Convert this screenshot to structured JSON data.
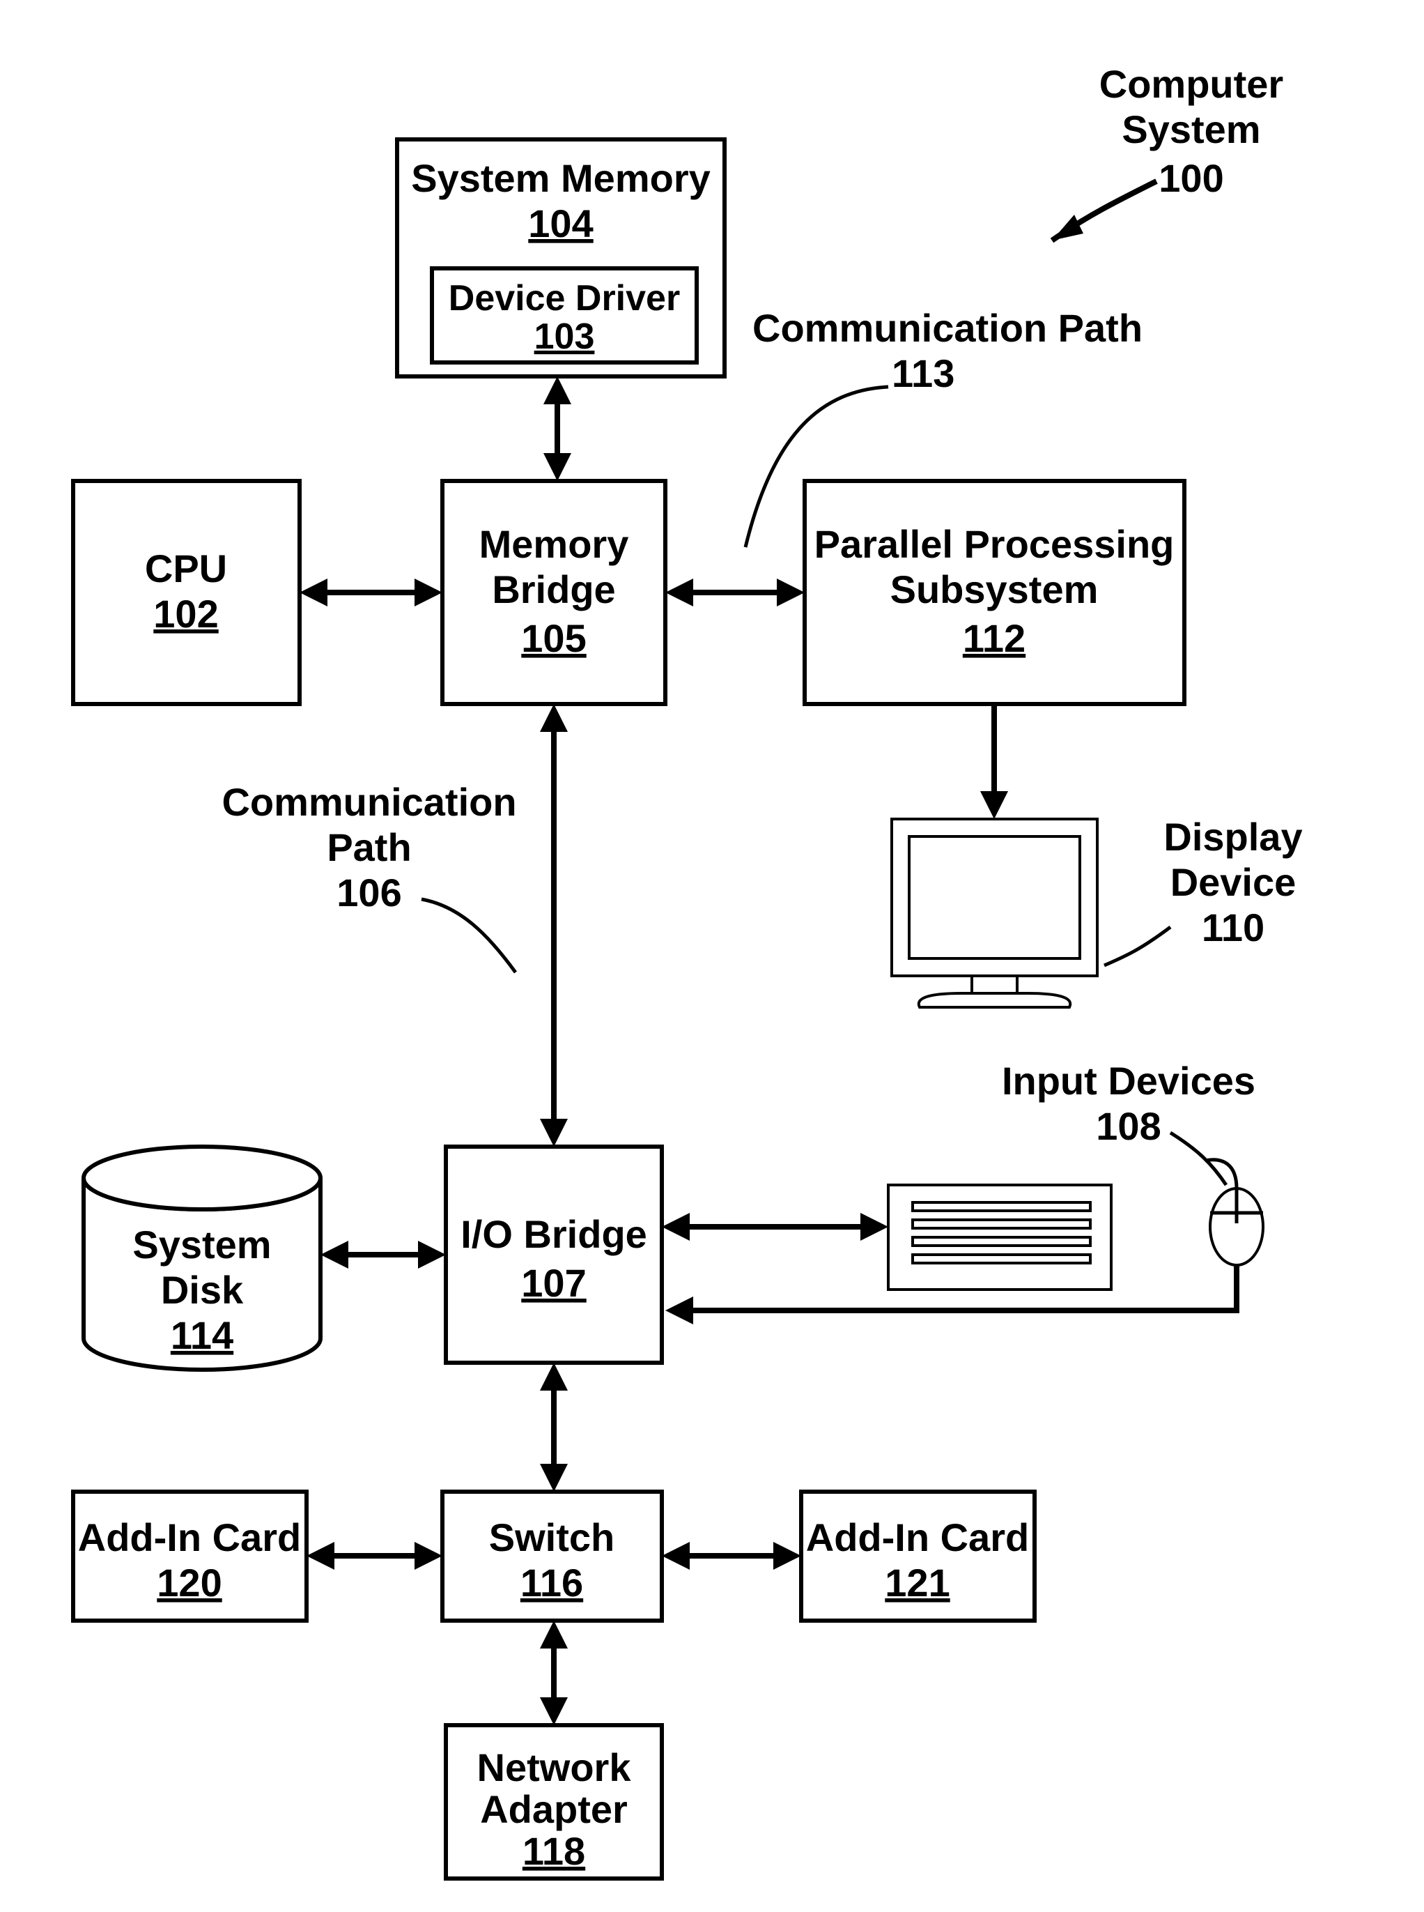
{
  "title": {
    "l1": "Computer",
    "l2": "System",
    "num": "100"
  },
  "sysmem": {
    "label": "System Memory",
    "num": "104"
  },
  "devdrv": {
    "label": "Device Driver",
    "num": "103"
  },
  "commpath113": {
    "l1": "Communication Path",
    "num": "113"
  },
  "cpu": {
    "label": "CPU",
    "num": "102"
  },
  "membridge": {
    "l1": "Memory",
    "l2": "Bridge",
    "num": "105"
  },
  "pps": {
    "l1": "Parallel Processing",
    "l2": "Subsystem",
    "num": "112"
  },
  "commpath106": {
    "l1": "Communication",
    "l2": "Path",
    "num": "106"
  },
  "display": {
    "l1": "Display",
    "l2": "Device",
    "num": "110"
  },
  "inputdev": {
    "label": "Input Devices",
    "num": "108"
  },
  "sysdisk": {
    "l1": "System",
    "l2": "Disk",
    "num": "114"
  },
  "iobridge": {
    "label": "I/O Bridge",
    "num": "107"
  },
  "addin120": {
    "label": "Add-In Card",
    "num": "120"
  },
  "switch": {
    "label": "Switch",
    "num": "116"
  },
  "addin121": {
    "label": "Add-In Card",
    "num": "121"
  },
  "netadp": {
    "l1": "Network",
    "l2": "Adapter",
    "num": "118"
  }
}
